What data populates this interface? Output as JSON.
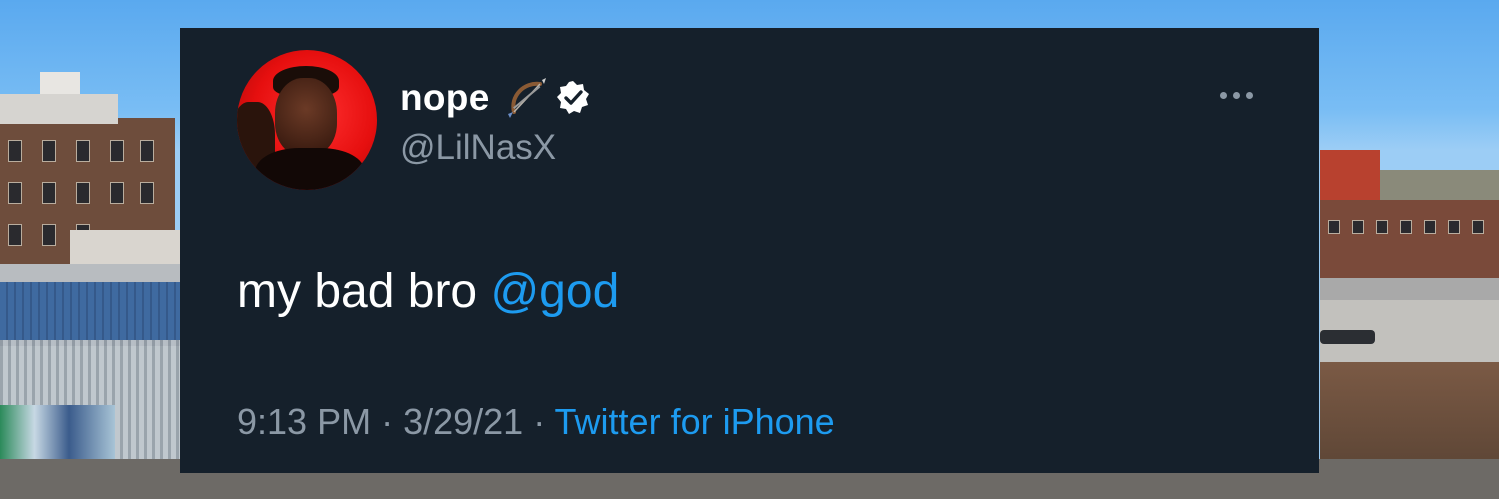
{
  "tweet": {
    "display_name": "nope",
    "display_name_emoji_icon": "bow-and-arrow-icon",
    "verified_icon": "verified-badge-icon",
    "handle": "@LilNasX",
    "text": "my bad bro ",
    "mention": "@god",
    "time": "9:13 PM",
    "separator": " · ",
    "date": "3/29/21",
    "client": "Twitter for iPhone"
  },
  "colors": {
    "card_background": "#15202b",
    "link_blue": "#1d9bf0",
    "secondary_text": "#8b98a5",
    "primary_text": "#ffffff"
  }
}
